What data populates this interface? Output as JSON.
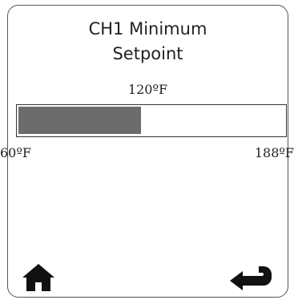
{
  "screen": {
    "title_line1": "CH1 Minimum",
    "title_line2": "Setpoint",
    "current_value": "120ºF"
  },
  "range": {
    "min_label": "60ºF",
    "max_label": "188ºF",
    "fill_fraction": 0.46
  },
  "icons": {
    "home": "home-icon",
    "back": "return-arrow-icon"
  },
  "colors": {
    "bar_fill": "#6c6c6c",
    "text": "#231f20"
  }
}
